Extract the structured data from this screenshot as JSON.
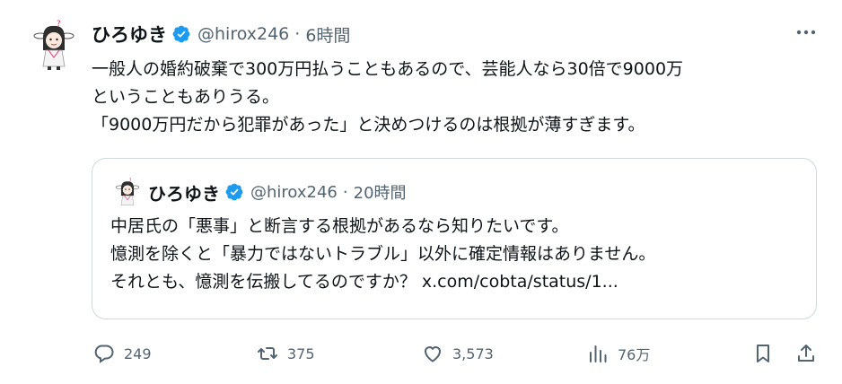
{
  "tweet": {
    "author_name": "ひろゆき",
    "handle": "@hirox246",
    "separator": "·",
    "time": "6時間",
    "lines": [
      "一般人の婚約破棄で300万円払うこともあるので、芸能人なら30倍で9000万",
      "ということもありうる。",
      "「9000万円だから犯罪があった」と決めつけるのは根拠が薄すぎます。"
    ]
  },
  "quoted": {
    "author_name": "ひろゆき",
    "handle": "@hirox246",
    "separator": "·",
    "time": "20時間",
    "lines": [
      "中居氏の「悪事」と断言する根拠があるなら知りたいです。",
      "憶測を除くと「暴力ではないトラブル」以外に確定情報はありません。",
      "それとも、憶測を伝搬してるのですか？ x.com/cobta/status/1..."
    ]
  },
  "actions": {
    "replies": "249",
    "retweets": "375",
    "likes": "3,573",
    "views": "76万"
  },
  "icons": {
    "verified": "verified-badge-icon",
    "more": "more-horizontal-icon",
    "reply": "reply-icon",
    "retweet": "retweet-icon",
    "like": "heart-icon",
    "views": "views-chart-icon",
    "bookmark": "bookmark-icon",
    "share": "share-icon"
  },
  "colors": {
    "verified": "#1d9bf0",
    "text": "#0f1419",
    "secondary": "#536471",
    "border": "#cfd9de"
  }
}
